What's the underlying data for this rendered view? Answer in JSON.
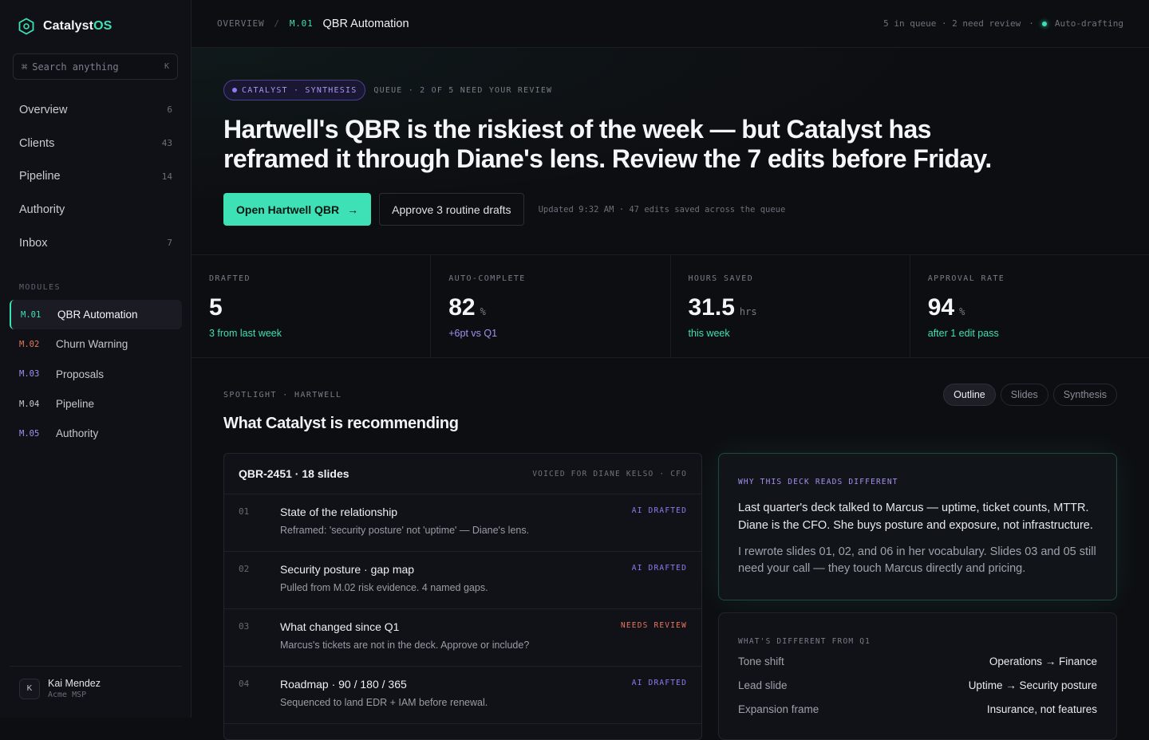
{
  "app": {
    "name_prefix": "Catalyst",
    "name_suffix": "OS"
  },
  "search": {
    "placeholder": "Search anything",
    "shortcut": "K"
  },
  "nav": [
    {
      "label": "Overview",
      "count": "6"
    },
    {
      "label": "Clients",
      "count": "43"
    },
    {
      "label": "Pipeline",
      "count": "14"
    },
    {
      "label": "Authority",
      "count": ""
    },
    {
      "label": "Inbox",
      "count": "7"
    }
  ],
  "modules": {
    "label": "MODULES",
    "items": [
      {
        "code": "M.01",
        "label": "QBR Automation",
        "color": "#3ee0b5"
      },
      {
        "code": "M.02",
        "label": "Churn Warning",
        "color": "#e8765e"
      },
      {
        "code": "M.03",
        "label": "Proposals",
        "color": "#a38ff0"
      },
      {
        "code": "M.04",
        "label": "Pipeline",
        "color": "#c9cbd3"
      },
      {
        "code": "M.05",
        "label": "Authority",
        "color": "#a38ff0"
      }
    ]
  },
  "user": {
    "initial": "K",
    "name": "Kai Mendez",
    "org": "Acme MSP"
  },
  "topbar": {
    "crumb_root": "OVERVIEW",
    "crumb_sep": "/",
    "crumb_code": "M.01",
    "crumb_current": "QBR Automation",
    "queue_status": "5 in queue · 2 need review",
    "dot_sep": "·",
    "live_status": "Auto-drafting"
  },
  "hero": {
    "pill": "CATALYST · SYNTHESIS",
    "queue_note": "QUEUE · 2 OF 5 NEED YOUR REVIEW",
    "headline": "Hartwell's QBR is the riskiest of the week — but Catalyst has reframed it through Diane's lens. Review the 7 edits before Friday.",
    "primary_button": "Open Hartwell QBR",
    "secondary_button": "Approve 3 routine drafts",
    "updated": "Updated 9:32 AM · 47 edits saved across the queue"
  },
  "stats": [
    {
      "label": "DRAFTED",
      "value": "5",
      "unit": "",
      "sub": "3 from last week",
      "tone": "green"
    },
    {
      "label": "AUTO-COMPLETE",
      "value": "82",
      "unit": "%",
      "sub": "+6pt vs Q1",
      "tone": "purple"
    },
    {
      "label": "HOURS SAVED",
      "value": "31.5",
      "unit": "hrs",
      "sub": "this week",
      "tone": "green"
    },
    {
      "label": "APPROVAL RATE",
      "value": "94",
      "unit": "%",
      "sub": "after 1 edit pass",
      "tone": "green"
    }
  ],
  "spotlight": {
    "label": "SPOTLIGHT · HARTWELL",
    "title": "What Catalyst is recommending",
    "tabs": [
      "Outline",
      "Slides",
      "Synthesis"
    ]
  },
  "outline": {
    "title": "QBR-2451 · 18 slides",
    "voice": "VOICED FOR DIANE KELSO · CFO",
    "rows": [
      {
        "num": "01",
        "title": "State of the relationship",
        "desc": "Reframed: 'security posture' not 'uptime' — Diane's lens.",
        "status": "AI DRAFTED",
        "kind": "ai"
      },
      {
        "num": "02",
        "title": "Security posture · gap map",
        "desc": "Pulled from M.02 risk evidence. 4 named gaps.",
        "status": "AI DRAFTED",
        "kind": "ai"
      },
      {
        "num": "03",
        "title": "What changed since Q1",
        "desc": "Marcus's tickets are not in the deck. Approve or include?",
        "status": "NEEDS REVIEW",
        "kind": "review"
      },
      {
        "num": "04",
        "title": "Roadmap · 90 / 180 / 365",
        "desc": "Sequenced to land EDR + IAM before renewal.",
        "status": "AI DRAFTED",
        "kind": "ai"
      }
    ]
  },
  "why": {
    "label": "WHY THIS DECK READS DIFFERENT",
    "p1": "Last quarter's deck talked to Marcus — uptime, ticket counts, MTTR. Diane is the CFO. She buys posture and exposure, not infrastructure.",
    "p2": "I rewrote slides 01, 02, and 06 in her vocabulary. Slides 03 and 05 still need your call — they touch Marcus directly and pricing."
  },
  "diff": {
    "label": "WHAT'S DIFFERENT FROM Q1",
    "rows": [
      {
        "key": "Tone shift",
        "value": "Operations → Finance"
      },
      {
        "key": "Lead slide",
        "value": "Uptime → Security posture"
      },
      {
        "key": "Expansion frame",
        "value": "Insurance, not features"
      }
    ]
  }
}
